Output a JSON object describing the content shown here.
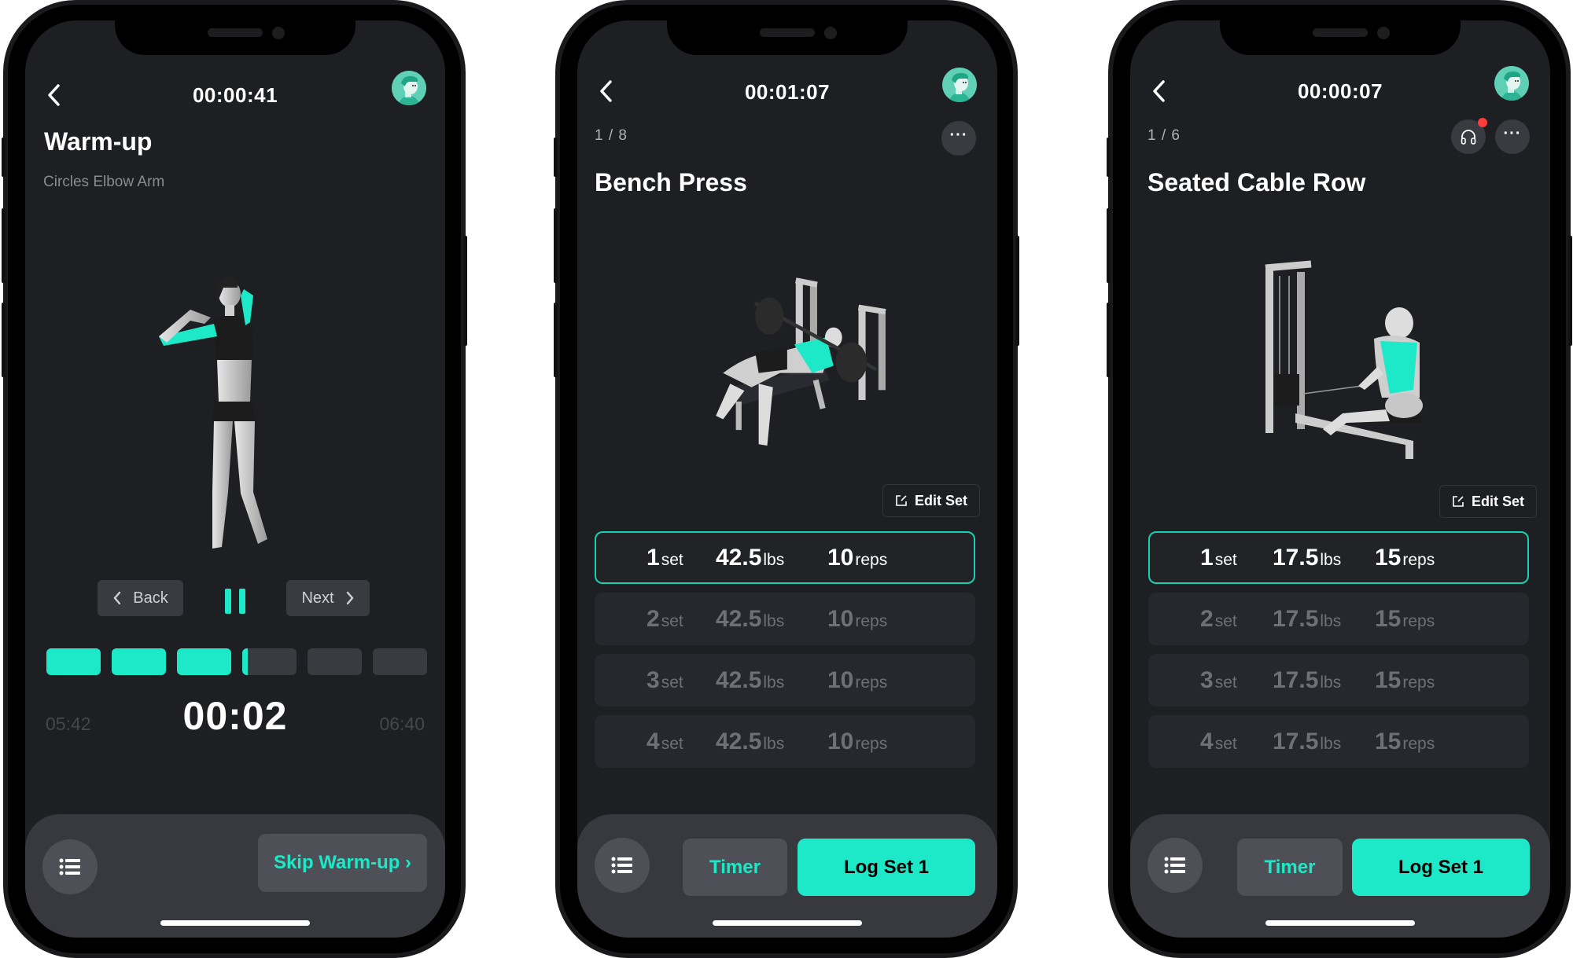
{
  "colors": {
    "accent": "#1de9c8",
    "background": "#1e1f22",
    "card": "#27282d",
    "notification": "#ff3b3b"
  },
  "phones": [
    {
      "header": {
        "elapsed": "00:00:41",
        "back_icon": "chevron-left-icon",
        "avatar": "user-avatar"
      },
      "title": "Warm-up",
      "subtitle": "Circles Elbow Arm",
      "illustration": "woman-circles-elbow-arm-figure",
      "controls": {
        "back_label": "Back",
        "next_label": "Next",
        "pause_icon": "pause-icon"
      },
      "progress": {
        "segments": [
          1,
          1,
          1,
          0.1,
          0,
          0
        ]
      },
      "time": {
        "left": "05:42",
        "current": "00:02",
        "right": "06:40"
      },
      "bottom": {
        "list_icon": "list-icon",
        "skip_label": "Skip Warm-up ›"
      }
    },
    {
      "header": {
        "elapsed": "00:01:07",
        "back_icon": "chevron-left-icon",
        "avatar": "user-avatar"
      },
      "counter": "1 / 8",
      "title": "Bench Press",
      "illustration": "bench-press-figure",
      "edit_set_label": "Edit Set",
      "sets": [
        {
          "set": "1",
          "set_unit": "set",
          "weight": "42.5",
          "weight_unit": "lbs",
          "reps": "10",
          "reps_unit": "reps",
          "active": true
        },
        {
          "set": "2",
          "set_unit": "set",
          "weight": "42.5",
          "weight_unit": "lbs",
          "reps": "10",
          "reps_unit": "reps",
          "active": false
        },
        {
          "set": "3",
          "set_unit": "set",
          "weight": "42.5",
          "weight_unit": "lbs",
          "reps": "10",
          "reps_unit": "reps",
          "active": false
        },
        {
          "set": "4",
          "set_unit": "set",
          "weight": "42.5",
          "weight_unit": "lbs",
          "reps": "10",
          "reps_unit": "reps",
          "active": false
        }
      ],
      "bottom": {
        "list_icon": "list-icon",
        "timer_label": "Timer",
        "log_label": "Log Set 1"
      }
    },
    {
      "header": {
        "elapsed": "00:00:07",
        "back_icon": "chevron-left-icon",
        "avatar": "user-avatar"
      },
      "counter": "1 / 6",
      "title": "Seated Cable Row",
      "illustration": "seated-cable-row-figure",
      "has_audio_notification": true,
      "edit_set_label": "Edit Set",
      "sets": [
        {
          "set": "1",
          "set_unit": "set",
          "weight": "17.5",
          "weight_unit": "lbs",
          "reps": "15",
          "reps_unit": "reps",
          "active": true
        },
        {
          "set": "2",
          "set_unit": "set",
          "weight": "17.5",
          "weight_unit": "lbs",
          "reps": "15",
          "reps_unit": "reps",
          "active": false
        },
        {
          "set": "3",
          "set_unit": "set",
          "weight": "17.5",
          "weight_unit": "lbs",
          "reps": "15",
          "reps_unit": "reps",
          "active": false
        },
        {
          "set": "4",
          "set_unit": "set",
          "weight": "17.5",
          "weight_unit": "lbs",
          "reps": "15",
          "reps_unit": "reps",
          "active": false
        }
      ],
      "bottom": {
        "list_icon": "list-icon",
        "timer_label": "Timer",
        "log_label": "Log Set 1"
      }
    }
  ]
}
